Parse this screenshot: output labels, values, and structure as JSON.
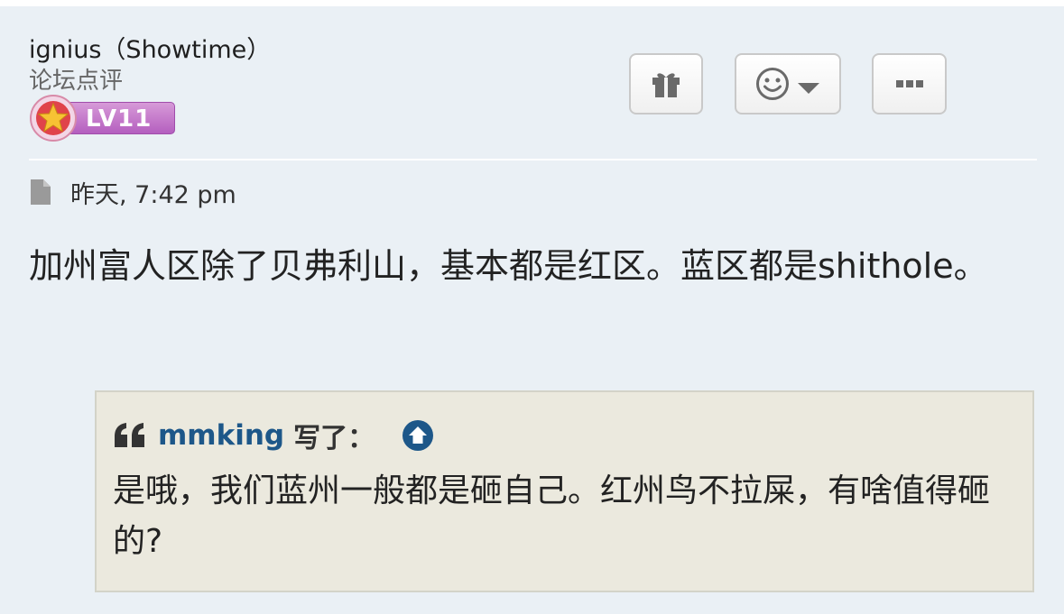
{
  "post": {
    "author": {
      "name": "ignius（Showtime）",
      "rank": "论坛点评",
      "level_badge": "LV11",
      "badge_colors": {
        "bar": "#bf6fc8",
        "medal": "#e0434a",
        "star": "#f7c234"
      }
    },
    "actions": {
      "gift_icon": "gift-icon",
      "react_icon": "smiley-icon",
      "react_dropdown_icon": "caret-down-icon",
      "more_icon": "ellipsis-icon"
    },
    "timestamp": "昨天, 7:42 pm",
    "timestamp_icon": "file-icon",
    "content": "加州富人区除了贝弗利山，基本都是红区。蓝区都是shithole。",
    "quote": {
      "quote_icon": "quote-mark-icon",
      "author": "mmking",
      "wrote_label": "写了：",
      "jump_icon": "arrow-up-circle-icon",
      "text": "是哦，我们蓝州一般都是砸自己。红州鸟不拉屎，有啥值得砸的?",
      "accent_color": "#1d5789"
    }
  }
}
